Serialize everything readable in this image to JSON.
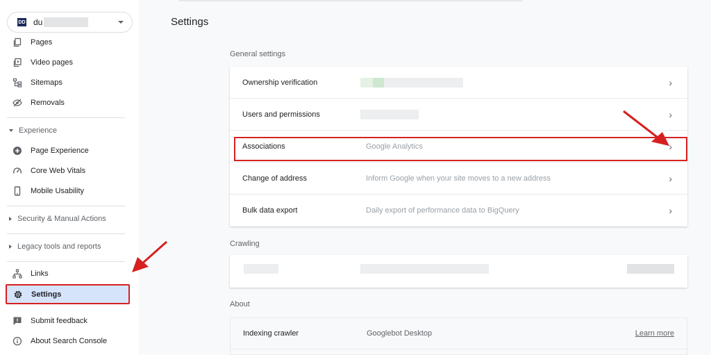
{
  "property": {
    "badge": "DD",
    "name": "du"
  },
  "sidebar": {
    "items_top": [
      {
        "label": "Pages",
        "icon": "pages-icon"
      },
      {
        "label": "Video pages",
        "icon": "video-pages-icon"
      },
      {
        "label": "Sitemaps",
        "icon": "sitemaps-icon"
      },
      {
        "label": "Removals",
        "icon": "removals-icon"
      }
    ],
    "experience": {
      "heading": "Experience",
      "items": [
        {
          "label": "Page Experience",
          "icon": "page-experience-icon"
        },
        {
          "label": "Core Web Vitals",
          "icon": "core-web-vitals-icon"
        },
        {
          "label": "Mobile Usability",
          "icon": "mobile-usability-icon"
        }
      ]
    },
    "security_heading": "Security & Manual Actions",
    "legacy_heading": "Legacy tools and reports",
    "links_label": "Links",
    "settings_label": "Settings",
    "submit_feedback_label": "Submit feedback",
    "about_label": "About Search Console"
  },
  "main": {
    "title": "Settings",
    "general": {
      "heading": "General settings",
      "rows": [
        {
          "label": "Ownership verification",
          "value": ""
        },
        {
          "label": "Users and permissions",
          "value": ""
        },
        {
          "label": "Associations",
          "value": "Google Analytics"
        },
        {
          "label": "Change of address",
          "value": "Inform Google when your site moves to a new address"
        },
        {
          "label": "Bulk data export",
          "value": "Daily export of performance data to BigQuery"
        }
      ]
    },
    "crawling": {
      "heading": "Crawling"
    },
    "about": {
      "heading": "About",
      "row_label": "Indexing crawler",
      "row_value": "Googlebot Desktop",
      "link": "Learn more"
    }
  },
  "colors": {
    "highlight": "#d62020",
    "active_nav": "#d6e4fb",
    "badge": "#1a2b5a"
  }
}
